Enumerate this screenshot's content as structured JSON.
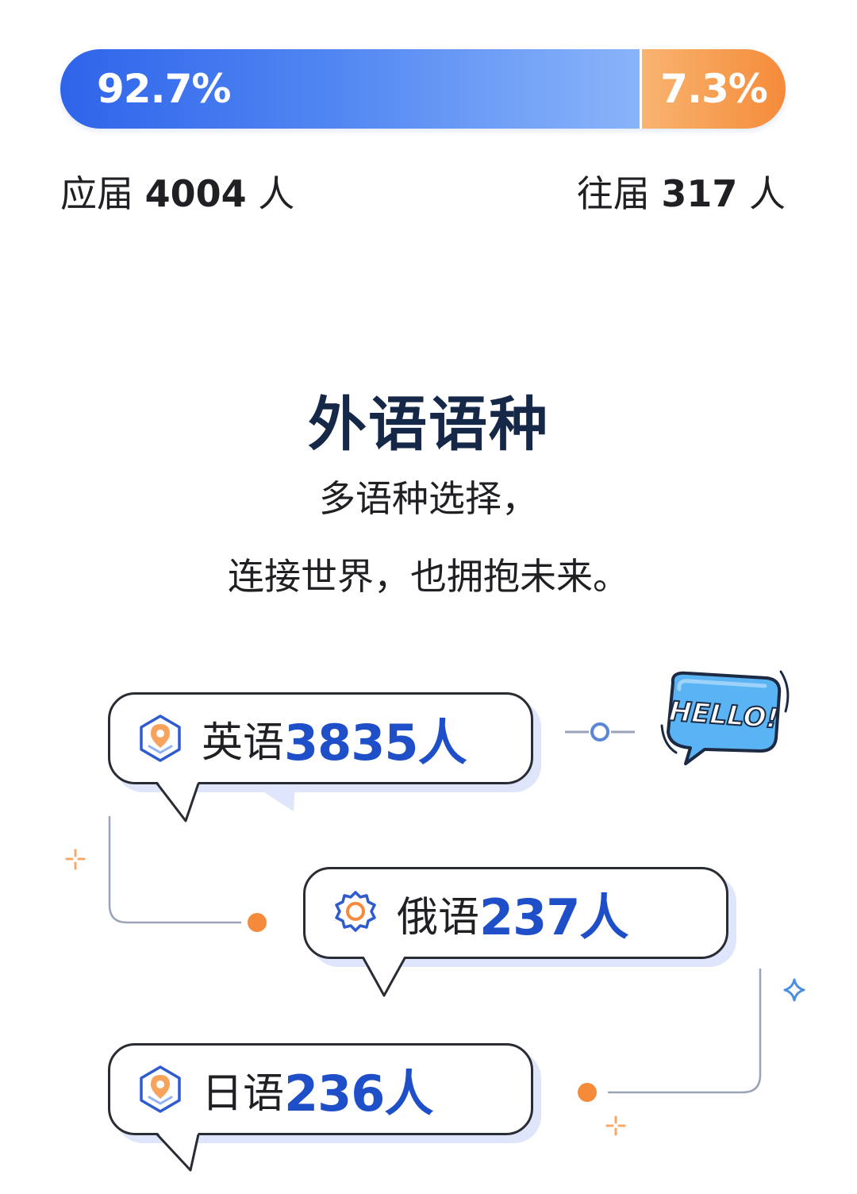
{
  "ratio_bar": {
    "fresh_pct_value": 92.7,
    "fresh_pct_label": "92.7%",
    "prev_pct_label": "7.3%",
    "fresh_color": "#2f64ea",
    "prev_color": "#f58b3a"
  },
  "counts": {
    "fresh_prefix": "应届",
    "fresh_value": "4004",
    "fresh_suffix": "人",
    "prev_prefix": "往届",
    "prev_value": "317",
    "prev_suffix": "人"
  },
  "section": {
    "title": "外语语种",
    "subtitle_line1": "多语种选择，",
    "subtitle_line2": "连接世界，也拥抱未来。"
  },
  "languages": [
    {
      "name": "英语",
      "count": "3835人",
      "icon": "location-pin-hexagon-icon"
    },
    {
      "name": "俄语",
      "count": "237人",
      "icon": "gear-icon"
    },
    {
      "name": "日语",
      "count": "236人",
      "icon": "location-pin-hexagon-icon"
    }
  ],
  "hello_badge": {
    "text": "HELLO!",
    "color": "#4aa8f0"
  },
  "accent": {
    "blue": "#1e4fc8",
    "orange": "#f58b3a",
    "line": "#9aa3b8"
  }
}
